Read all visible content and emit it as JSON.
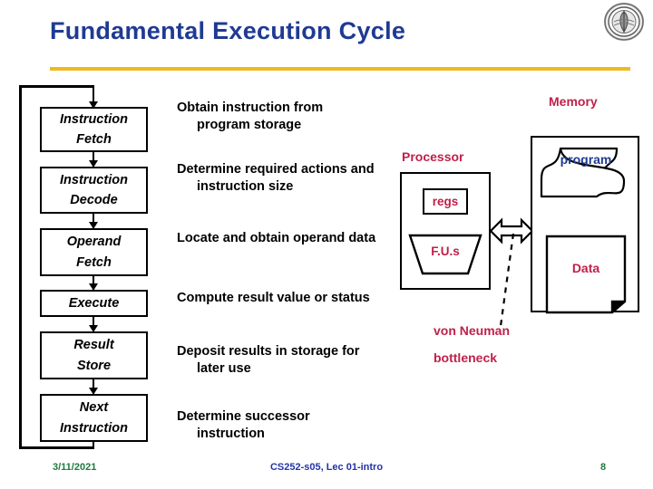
{
  "slide": {
    "title": "Fundamental Execution Cycle",
    "accent_rule_color": "#EFB920",
    "title_color": "#1F3A93"
  },
  "logo": {
    "name": "university-seal"
  },
  "flowchart": {
    "stages": [
      {
        "line1": "Instruction",
        "line2": "Fetch"
      },
      {
        "line1": "Instruction",
        "line2": "Decode"
      },
      {
        "line1": "Operand",
        "line2": "Fetch"
      },
      {
        "line1": "Execute",
        "line2": ""
      },
      {
        "line1": "Result",
        "line2": "Store"
      },
      {
        "line1": "Next",
        "line2": "Instruction"
      }
    ]
  },
  "descriptions": [
    "Obtain instruction from program storage",
    "Determine required actions and instruction size",
    "Locate and obtain operand data",
    "Compute result value or status",
    "Deposit results in storage for later use",
    "Determine successor instruction"
  ],
  "architecture": {
    "processor_label": "Processor",
    "regs_label": "regs",
    "fus_label": "F.U.s",
    "memory_label": "Memory",
    "program_label": "program",
    "data_label": "Data",
    "annotation_line1": "von Neuman",
    "annotation_line2": "bottleneck",
    "label_color": "#C0204A",
    "program_color": "#1F3A93"
  },
  "footer": {
    "date": "3/11/2021",
    "course": "CS252-s05, Lec 01-intro",
    "page": "8",
    "date_color": "#1E7A3C",
    "course_color": "#2233AA"
  }
}
